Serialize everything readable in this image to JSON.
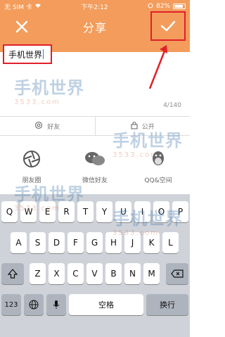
{
  "status": {
    "carrier": "无 SIM 卡",
    "time": "下午2:12",
    "battery": "82%"
  },
  "nav": {
    "title": "分享"
  },
  "compose": {
    "text": "手机世界",
    "char_count": "4/140"
  },
  "audience": {
    "left_label": "好友",
    "right_label": "公开"
  },
  "share_targets": [
    {
      "label": "朋友圈"
    },
    {
      "label": "微信好友"
    },
    {
      "label": "QQ&空间"
    }
  ],
  "watermark": {
    "brand": "手机世界",
    "sub": "3533.com"
  },
  "keyboard": {
    "row1": [
      "Q",
      "W",
      "E",
      "R",
      "T",
      "Y",
      "U",
      "I",
      "O",
      "P"
    ],
    "row2": [
      "A",
      "S",
      "D",
      "F",
      "G",
      "H",
      "J",
      "K",
      "L"
    ],
    "row3": [
      "Z",
      "X",
      "C",
      "V",
      "B",
      "N",
      "M"
    ],
    "numbers_key": "123",
    "space_key": "空格",
    "return_key": "换行"
  },
  "colors": {
    "header_orange": "#f39c5b",
    "annotation_red": "#e0202a",
    "keyboard_bg": "#cfd3d9"
  }
}
